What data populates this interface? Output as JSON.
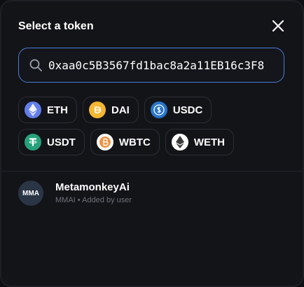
{
  "modal": {
    "title": "Select a token"
  },
  "search": {
    "value": "0xaa0c5B3567fd1bac8a2a11EB16c3F8"
  },
  "common_tokens": [
    [
      {
        "symbol": "ETH",
        "icon": "eth-icon",
        "color": "#627eea"
      },
      {
        "symbol": "DAI",
        "icon": "dai-icon",
        "color": "#f4b731"
      },
      {
        "symbol": "USDC",
        "icon": "usdc-icon",
        "color": "#2775ca"
      }
    ],
    [
      {
        "symbol": "USDT",
        "icon": "usdt-icon",
        "color": "#26a17b"
      },
      {
        "symbol": "WBTC",
        "icon": "wbtc-icon",
        "color": "#f09242"
      },
      {
        "symbol": "WETH",
        "icon": "weth-icon",
        "color": "#ffffff"
      }
    ]
  ],
  "results": [
    {
      "avatar_text": "MMA",
      "name": "MetamonkeyAi",
      "symbol": "MMAI",
      "separator": "•",
      "note": "Added by user"
    }
  ],
  "colors": {
    "accent": "#4a7bd9",
    "background": "#131418"
  }
}
